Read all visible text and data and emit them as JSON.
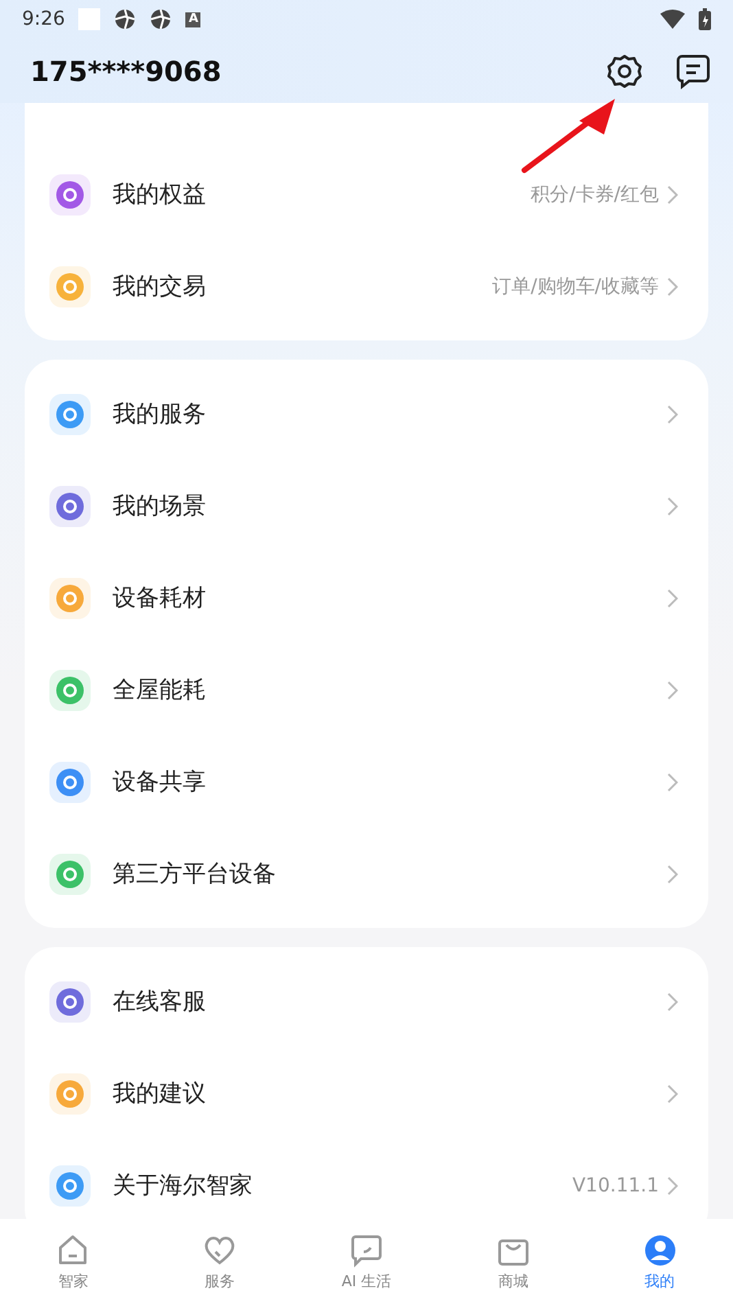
{
  "status_bar": {
    "time": "9:26",
    "letter_badge": "A"
  },
  "header": {
    "title": "175****9068"
  },
  "annotation": {
    "kind": "arrow"
  },
  "groups": [
    {
      "items": [
        {
          "label": "我的权益",
          "color": "#a259e6",
          "hint": "积分/卡券/红包"
        },
        {
          "label": "我的交易",
          "color": "#f7b23b",
          "hint": "订单/购物车/收藏等"
        }
      ]
    },
    {
      "items": [
        {
          "label": "我的服务",
          "color": "#3d9bf5"
        },
        {
          "label": "我的场景",
          "color": "#6f6cdc"
        },
        {
          "label": "设备耗材",
          "color": "#f7a93b"
        },
        {
          "label": "全屋能耗",
          "color": "#3cc168"
        },
        {
          "label": "设备共享",
          "color": "#3d8ff5"
        },
        {
          "label": "第三方平台设备",
          "color": "#3cc168"
        }
      ]
    },
    {
      "items": [
        {
          "label": "在线客服",
          "color": "#6f6cdc"
        },
        {
          "label": "我的建议",
          "color": "#f7a93b"
        },
        {
          "label": "关于海尔智家",
          "color": "#3d9bf5",
          "hint": "V10.11.1"
        }
      ]
    }
  ],
  "tabbar": [
    {
      "label": "智家",
      "selected": false
    },
    {
      "label": "服务",
      "selected": false
    },
    {
      "label": "AI 生活",
      "selected": false
    },
    {
      "label": "商城",
      "selected": false
    },
    {
      "label": "我的",
      "selected": true
    }
  ]
}
